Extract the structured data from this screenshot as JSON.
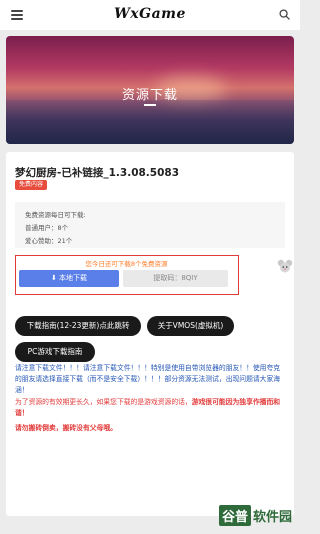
{
  "header": {
    "logo": "WxGame",
    "menu_icon": "menu-icon",
    "search_icon": "search-icon"
  },
  "banner": {
    "title": "资源下载"
  },
  "resource": {
    "title": "梦幻厨房-已补链接_1.3.08.5083",
    "badge": "免费内容",
    "info": [
      "免费资源每日可下载:",
      "普通用户：8个",
      "爱心赞助：21个"
    ]
  },
  "download": {
    "notice": "您今日还可下载8个免费资源",
    "local_button": "本地下载",
    "code_label": "提取码：",
    "code_value": "8QIY"
  },
  "actions": {
    "guide_button": "下载指南(12-23更新)点此跳转",
    "vmos_button": "关于VMOS(虚拟机)",
    "pc_guide_button": "PC游戏下载指南"
  },
  "notices": {
    "blue": "请注意下载文件！！！请注意下载文件！！！特别是使用自带浏览器的朋友！！使用夸克的朋友请选择直接下载（而不是安全下载）！！！部分资源无法测试，出现问题请大家海涵！",
    "red_plain": "为了资源的有效期更长久，如果您下载的是游戏资源的话，",
    "red_bold": "游戏很可能因为独享作播而和谐！",
    "red_final": "请勿搬砖倒卖，搬砖没有父母哦。"
  },
  "watermark": {
    "boxed": "谷普",
    "text": "软件园"
  }
}
